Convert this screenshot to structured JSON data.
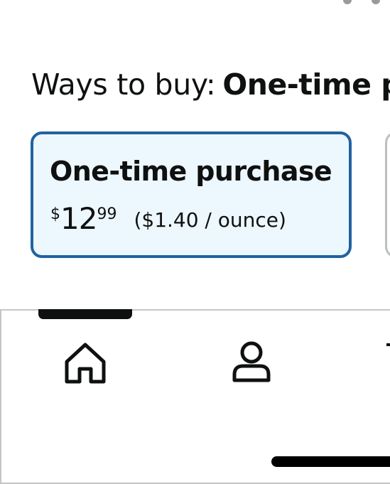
{
  "purchase_options": {
    "ways_label": "Ways to buy:",
    "selected_value": "One-time p",
    "selected_option": {
      "title": "One-time purchase",
      "price_symbol": "$",
      "price_whole": "12",
      "price_fraction": "99",
      "unit_price": "($1.40 / ounce)"
    }
  },
  "bottom_nav": {
    "items": [
      {
        "icon": "home-icon",
        "active": true
      },
      {
        "icon": "account-icon",
        "active": false
      },
      {
        "icon": "cart-icon",
        "active": false
      }
    ]
  },
  "colors": {
    "selected_border": "#2162a1",
    "selected_background": "#edf7fe",
    "text": "#0f1111"
  }
}
